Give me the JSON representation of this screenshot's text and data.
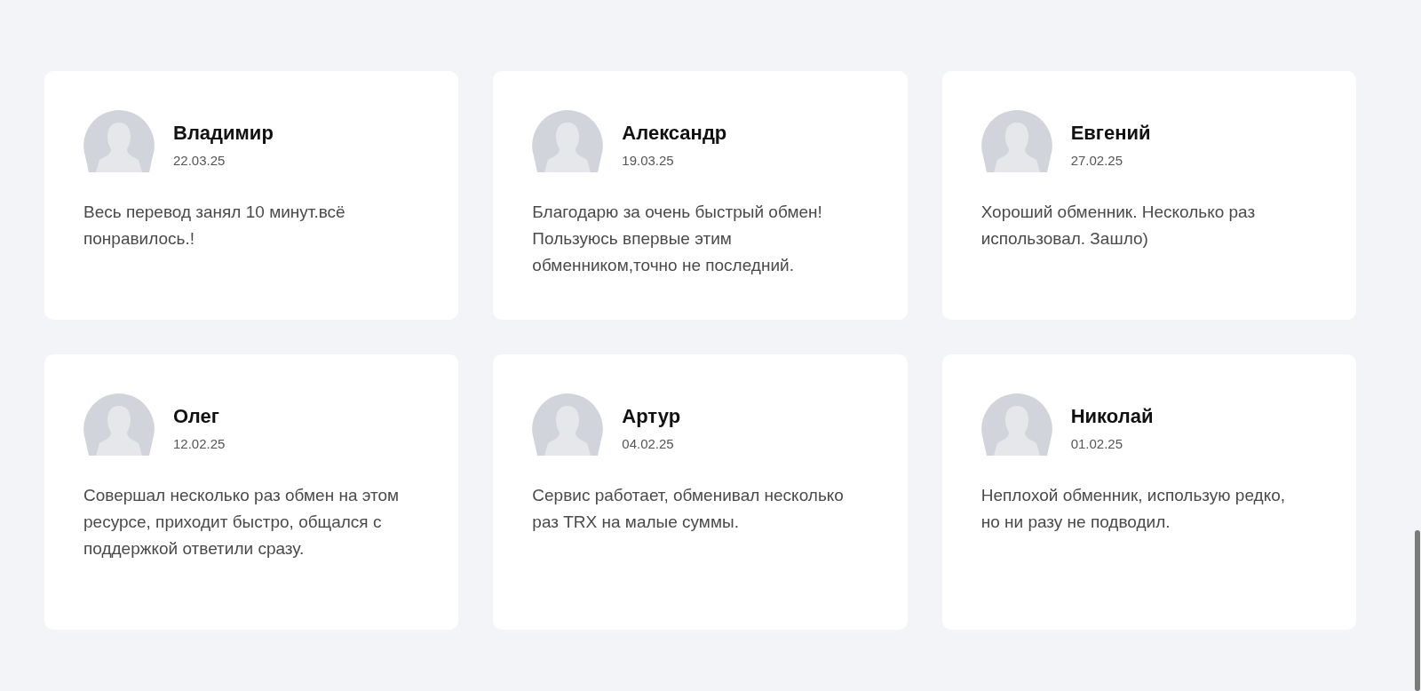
{
  "reviews": [
    {
      "name": "Владимир",
      "date": "22.03.25",
      "text": "Весь перевод занял 10 минут.всё понравилось.!"
    },
    {
      "name": "Александр",
      "date": "19.03.25",
      "text": "Благодарю за очень быстрый обмен! Пользуюсь впервые этим обменником,точно не последний."
    },
    {
      "name": "Евгений",
      "date": "27.02.25",
      "text": "Хороший обменник. Несколько раз использовал. Зашло)"
    },
    {
      "name": "Олег",
      "date": "12.02.25",
      "text": "Совершал несколько раз обмен на этом ресурсе, приходит быстро, общался с поддержкой ответили сразу."
    },
    {
      "name": "Артур",
      "date": "04.02.25",
      "text": "Сервис работает, обменивал несколько раз TRX на малые суммы."
    },
    {
      "name": "Николай",
      "date": "01.02.25",
      "text": "Неплохой обменник, использую редко, но ни разу не подводил."
    }
  ]
}
